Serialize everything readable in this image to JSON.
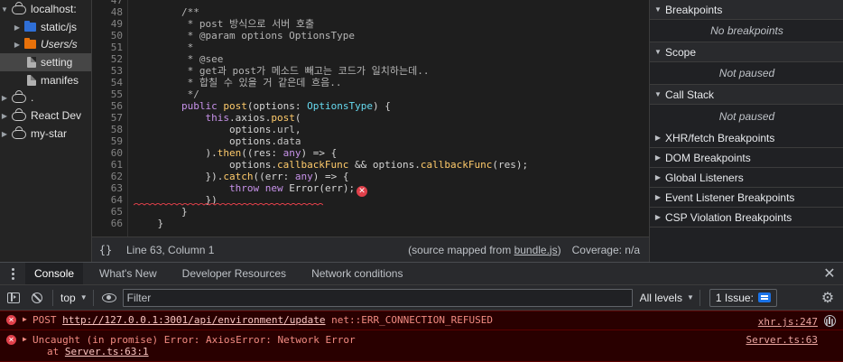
{
  "file_tree": {
    "items": [
      {
        "label": "localhost:"
      },
      {
        "label": "static/js"
      },
      {
        "label": "Users/s"
      },
      {
        "label": "setting"
      },
      {
        "label": "manifes"
      },
      {
        "label": "."
      },
      {
        "label": "React Dev"
      },
      {
        "label": "my-star"
      }
    ]
  },
  "editor": {
    "line_numbers": [
      "47",
      "48",
      "49",
      "50",
      "51",
      "52",
      "53",
      "54",
      "55",
      "56",
      "57",
      "58",
      "59",
      "60",
      "61",
      "62",
      "63",
      "64",
      "65",
      "66"
    ],
    "lines": [
      "",
      "        /**",
      "         * post 방식으로 서버 호출",
      "         * @param options OptionsType",
      "         *",
      "         * @see",
      "         * get과 post가 메소드 빼고는 코드가 일치하는데..",
      "         * 합칠 수 있을 거 같은데 흐음..",
      "         */",
      "        public post(options: OptionsType) {",
      "            this.axios.post(",
      "                options.url,",
      "                options.data",
      "            ).then((res: any) => {",
      "                options.callbackFunc && options.callbackFunc(res);",
      "            }).catch((err: any) => {",
      "                throw new Error(err);",
      "            })",
      "        }",
      "    }"
    ]
  },
  "status_bar": {
    "braces": "{}",
    "cursor": "Line 63, Column 1",
    "source_prefix": "(source mapped from ",
    "source_file": "bundle.js",
    "source_suffix": ")",
    "coverage": "Coverage: n/a"
  },
  "debugger": {
    "breakpoints": {
      "title": "Breakpoints",
      "body": "No breakpoints"
    },
    "scope": {
      "title": "Scope",
      "body": "Not paused"
    },
    "call_stack": {
      "title": "Call Stack",
      "body": "Not paused"
    },
    "collapsed": [
      "XHR/fetch Breakpoints",
      "DOM Breakpoints",
      "Global Listeners",
      "Event Listener Breakpoints",
      "CSP Violation Breakpoints"
    ]
  },
  "drawer": {
    "tabs": [
      "Console",
      "What's New",
      "Developer Resources",
      "Network conditions"
    ]
  },
  "console_toolbar": {
    "context": "top",
    "filter_placeholder": "Filter",
    "levels": "All levels",
    "issues": "1 Issue:"
  },
  "messages": [
    {
      "method": "POST",
      "url": "http://127.0.0.1:3001/api/environment/update",
      "error": "net::ERR_CONNECTION_REFUSED",
      "source": "xhr.js:247"
    },
    {
      "text": "Uncaught (in promise) Error: AxiosError: Network Error",
      "at_prefix": "at ",
      "at_link": "Server.ts:63:1",
      "source": "Server.ts:63"
    }
  ],
  "colors": {
    "error": "#e0404a",
    "error_text": "#f28b82",
    "error_bg": "#290000",
    "keyword": "#c792ea",
    "function": "#ffcb6b",
    "type": "#66d9ef"
  }
}
